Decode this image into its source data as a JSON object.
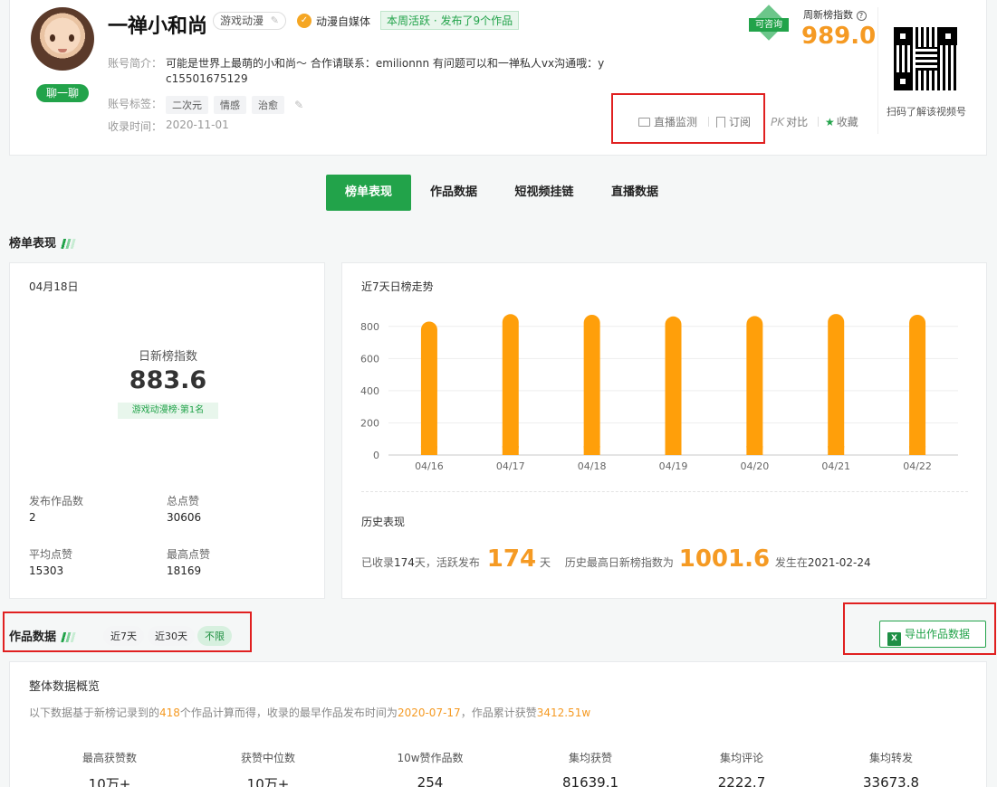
{
  "profile": {
    "name": "一禅小和尚",
    "category_tag": "游戏动漫",
    "verified_label": "动漫自媒体",
    "activity_badge": "本周活跃 · 发布了9个作品",
    "chat_button": "聊一聊",
    "intro_label": "账号简介：",
    "intro_line1": "可能是世界上最萌的小和尚～ 合作请联系：emilionnn 有问题可以和一禅私人vx沟通哦：y",
    "intro_line2": "c15501675129",
    "tags_label": "账号标签：",
    "tags": [
      "二次元",
      "情感",
      "治愈"
    ],
    "collected_label": "收录时间：",
    "collected_date": "2020-11-01"
  },
  "index_panel": {
    "consult_badge": "可咨询",
    "weekly_label": "周新榜指数",
    "weekly_value": "989.0",
    "qr_caption": "扫码了解该视频号"
  },
  "actions": {
    "live_monitor": "直播监测",
    "subscribe": "订阅",
    "compare_pk": "PK",
    "compare": "对比",
    "favorite": "收藏"
  },
  "tabs": [
    "榜单表现",
    "作品数据",
    "短视频挂链",
    "直播数据"
  ],
  "ranking_section": {
    "title": "榜单表现",
    "date": "04月18日",
    "daily_index_label": "日新榜指数",
    "daily_index_value": "883.6",
    "rank_badge": "游戏动漫榜·第1名",
    "stats": [
      {
        "label": "发布作品数",
        "value": "2"
      },
      {
        "label": "总点赞",
        "value": "30606"
      },
      {
        "label": "平均点赞",
        "value": "15303"
      },
      {
        "label": "最高点赞",
        "value": "18169"
      }
    ]
  },
  "chart_panel": {
    "title": "近7天日榜走势",
    "history_title": "历史表现",
    "history_prefix": "已收录",
    "history_collected_days": "174",
    "history_mid": "天，活跃发布",
    "history_active_days": "174",
    "history_unit": "天",
    "history_max_label": "历史最高日新榜指数为",
    "history_max_value": "1001.6",
    "history_date_label": "发生在",
    "history_date": "2021-02-24"
  },
  "chart_data": {
    "type": "bar",
    "categories": [
      "04/16",
      "04/17",
      "04/18",
      "04/19",
      "04/20",
      "04/21",
      "04/22"
    ],
    "values": [
      830,
      876,
      872,
      862,
      864,
      877,
      872
    ],
    "ylim": [
      0,
      900
    ],
    "yticks": [
      0,
      200,
      400,
      600,
      800
    ],
    "color": "#ff9f0a",
    "grid": true
  },
  "works_section": {
    "title": "作品数据",
    "filters": [
      "近7天",
      "近30天",
      "不限"
    ],
    "active_filter": "不限",
    "export_button": "导出作品数据",
    "overview_title": "整体数据概览",
    "desc_prefix": "以下数据基于新榜记录到的",
    "desc_count": "418",
    "desc_mid": "个作品计算而得，收录的最早作品发布时间为",
    "desc_date": "2020-07-17",
    "desc_mid2": "，作品累计获赞",
    "desc_likes": "3412.51w",
    "metrics": [
      {
        "label": "最高获赞数",
        "value": "10万+"
      },
      {
        "label": "获赞中位数",
        "value": "10万+"
      },
      {
        "label": "10w赞作品数",
        "value": "254"
      },
      {
        "label": "集均获赞",
        "value": "81639.1"
      },
      {
        "label": "集均评论",
        "value": "2222.7"
      },
      {
        "label": "集均转发",
        "value": "33673.8"
      }
    ]
  },
  "colors": {
    "brand_green": "#22a34a",
    "accent_orange": "#f59a23",
    "highlight_red": "#e02020"
  }
}
